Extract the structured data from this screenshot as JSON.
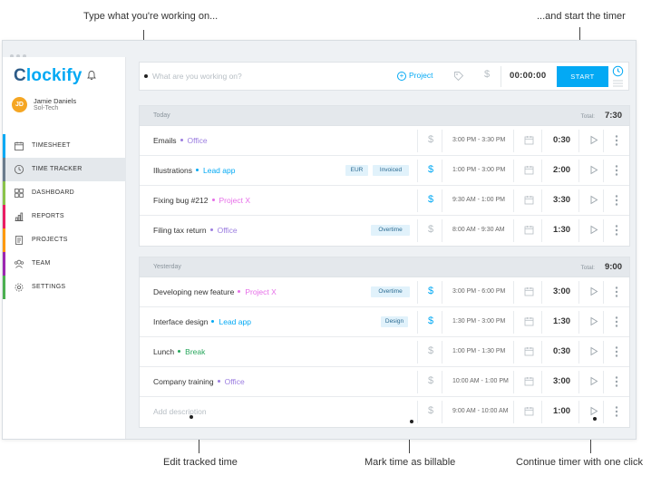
{
  "annotations": {
    "top_left": "Type what you're working on...",
    "top_right": "...and start the timer",
    "bottom_left": "Edit tracked time",
    "bottom_mid": "Mark time as billable",
    "bottom_right": "Continue timer with one click"
  },
  "app": {
    "logo": "lockify",
    "logo_c": "C"
  },
  "user": {
    "initials": "JD",
    "name": "Jamie Daniels",
    "org": "Sol-Tech"
  },
  "sidebar": {
    "items": [
      {
        "label": "TIMESHEET",
        "icon": "calendar-icon",
        "color": "#03a9f4"
      },
      {
        "label": "TIME TRACKER",
        "icon": "clock-icon",
        "color": "#6b7c8c",
        "active": true
      },
      {
        "label": "DASHBOARD",
        "icon": "grid-icon",
        "color": "#8bc34a"
      },
      {
        "label": "REPORTS",
        "icon": "bar-chart-icon",
        "color": "#e91e63"
      },
      {
        "label": "PROJECTS",
        "icon": "document-icon",
        "color": "#ff9800"
      },
      {
        "label": "TEAM",
        "icon": "team-icon",
        "color": "#9c27b0"
      },
      {
        "label": "SETTINGS",
        "icon": "gear-icon",
        "color": "#4caf50"
      }
    ]
  },
  "timer": {
    "placeholder": "What are you working on?",
    "project_label": "Project",
    "time": "00:00:00",
    "start_label": "START"
  },
  "groups": [
    {
      "label": "Today",
      "total_label": "Total:",
      "total": "7:30",
      "rows": [
        {
          "desc": "Emails",
          "project": "Office",
          "project_color": "#9b7de0",
          "tags": [],
          "billable": false,
          "range": "3:00 PM - 3:30 PM",
          "duration": "0:30"
        },
        {
          "desc": "Illustrations",
          "project": "Lead app",
          "project_color": "#03a9f4",
          "tags": [
            "EUR",
            "Invoiced"
          ],
          "billable": true,
          "range": "1:00 PM - 3:00 PM",
          "duration": "2:00"
        },
        {
          "desc": "Fixing bug #212",
          "project": "Project X",
          "project_color": "#e66ee8",
          "tags": [],
          "billable": true,
          "range": "9:30 AM - 1:00 PM",
          "duration": "3:30"
        },
        {
          "desc": "Filing tax return",
          "project": "Office",
          "project_color": "#9b7de0",
          "tags": [
            "Overtime"
          ],
          "billable": false,
          "range": "8:00 AM - 9:30 AM",
          "duration": "1:30"
        }
      ]
    },
    {
      "label": "Yesterday",
      "total_label": "Total:",
      "total": "9:00",
      "rows": [
        {
          "desc": "Developing new feature",
          "project": "Project X",
          "project_color": "#e66ee8",
          "tags": [
            "Overtime"
          ],
          "billable": true,
          "range": "3:00 PM - 6:00 PM",
          "duration": "3:00"
        },
        {
          "desc": "Interface design",
          "project": "Lead app",
          "project_color": "#03a9f4",
          "tags": [
            "Design"
          ],
          "billable": true,
          "range": "1:30 PM - 3:00 PM",
          "duration": "1:30"
        },
        {
          "desc": "Lunch",
          "project": "Break",
          "project_color": "#26a65b",
          "tags": [],
          "billable": false,
          "range": "1:00 PM - 1:30 PM",
          "duration": "0:30"
        },
        {
          "desc": "Company training",
          "project": "Office",
          "project_color": "#9b7de0",
          "tags": [],
          "billable": false,
          "range": "10:00 AM - 1:00 PM",
          "duration": "3:00"
        },
        {
          "desc": "",
          "placeholder": "Add description",
          "project": "",
          "project_color": "",
          "tags": [],
          "billable": false,
          "range": "9:00 AM - 10:00 AM",
          "duration": "1:00"
        }
      ]
    }
  ]
}
